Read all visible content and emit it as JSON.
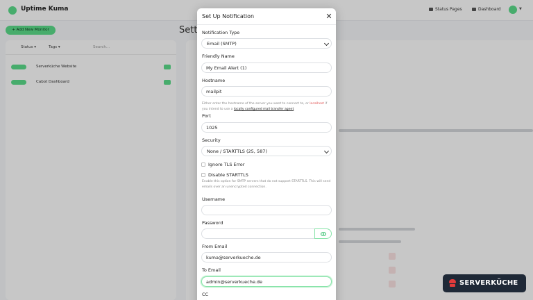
{
  "app": {
    "name": "Uptime Kuma",
    "nav": {
      "status_pages": "Status Pages",
      "dashboard": "Dashboard"
    },
    "add_monitor_label": "+ Add New Monitor",
    "background_title": "Setti",
    "filters": {
      "status": "Status",
      "tags": "Tags",
      "search_placeholder": "Search..."
    },
    "monitors": [
      {
        "name": "Serverküche Website",
        "status": "up"
      },
      {
        "name": "Cabot Dashboard",
        "status": "up"
      }
    ]
  },
  "modal": {
    "title": "Set Up Notification",
    "notification_type": {
      "label": "Notification Type",
      "value": "Email (SMTP)"
    },
    "friendly_name": {
      "label": "Friendly Name",
      "value": "My Email Alert (1)"
    },
    "hostname": {
      "label": "Hostname",
      "value": "mailpit",
      "help_part1": "Either enter the hostname of the server you want to connect to, or",
      "help_localhost": "localhost",
      "help_part2": "if you intend to use a",
      "help_link": "locally configured mail transfer agent"
    },
    "port": {
      "label": "Port",
      "value": "1025"
    },
    "security": {
      "label": "Security",
      "value": "None / STARTTLS (25, 587)"
    },
    "ignore_tls": {
      "label": "Ignore TLS Error",
      "checked": false
    },
    "disable_starttls": {
      "label": "Disable STARTTLS",
      "checked": false,
      "help": "Enable this option for SMTP servers that do not support STARTTLS. This will send emails over an unencrypted connection."
    },
    "username": {
      "label": "Username",
      "value": ""
    },
    "password": {
      "label": "Password",
      "value": ""
    },
    "from_email": {
      "label": "From Email",
      "value": "kuma@serverkueche.de"
    },
    "to_email": {
      "label": "To Email",
      "value": "admin@serverkueche.de"
    },
    "cc": {
      "label": "CC"
    }
  },
  "watermark": {
    "text": "SERVERKÜCHE"
  },
  "colors": {
    "accent": "#5cdd8b",
    "danger": "#e05252",
    "watermark_bg": "#1f2937"
  }
}
